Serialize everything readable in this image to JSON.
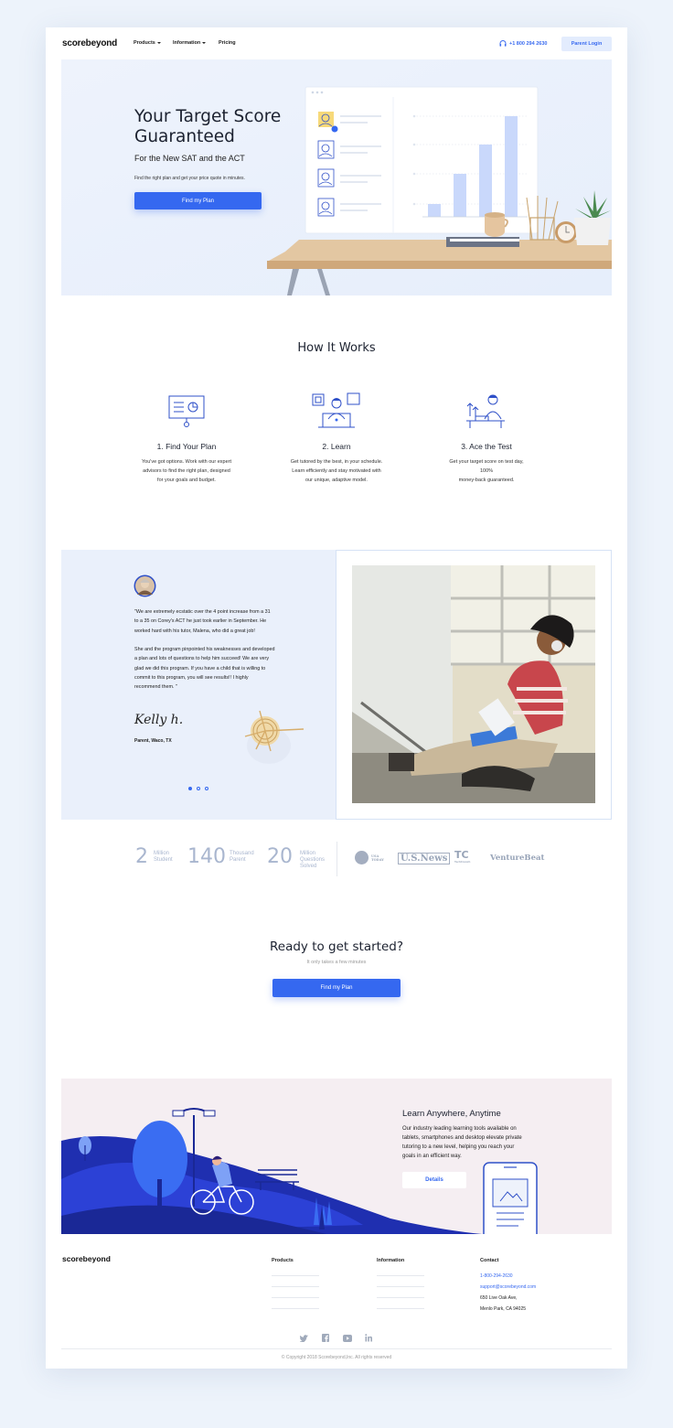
{
  "nav": {
    "logo": "scorebeyond",
    "items": [
      "Products",
      "Information",
      "Pricing"
    ],
    "phone": "+1 800 294 2630",
    "login": "Parent Login"
  },
  "hero": {
    "title_line1": "Your Target Score",
    "title_line2": "Guaranteed",
    "subtitle": "For the New SAT and the ACT",
    "small": "Find the right plan and get your price quote in minutes.",
    "cta": "Find my Plan"
  },
  "how": {
    "title": "How It Works",
    "steps": [
      {
        "title": "1. Find Your Plan",
        "lines": [
          "You've got options. Work with our expert",
          "advisors to find the right plan, designed",
          "for your goals and budget."
        ]
      },
      {
        "title": "2. Learn",
        "lines": [
          "Get tutored by the best, in your schedule.",
          "Learn efficiently and stay motivated with",
          "our unique, adaptive model."
        ]
      },
      {
        "title": "3. Ace the Test",
        "lines": [
          "Get your target score on test day,",
          "100%",
          "money-back guaranteed."
        ]
      }
    ]
  },
  "testimonial": {
    "p1": [
      "\"We are extremely ecstatic over the 4 point increase from a 31",
      "to a 35 on Corey's ACT he just took earlier in September. He",
      "worked hard with his tutor, Malena, who did a great job!"
    ],
    "p2": [
      "She and the program pinpointed his weaknesses and developed",
      "a plan and lots of questions to help him succeed! We are very",
      "glad we did this program. If you have a child that is willing to",
      "commit to this program, you will see results!! I highly",
      "recommend them. \""
    ],
    "signature": "Kelly h.",
    "role": "Parent, Waco, TX"
  },
  "stats": [
    {
      "num": "2",
      "label1": "Million",
      "label2": "Student"
    },
    {
      "num": "140",
      "label1": "Thousand",
      "label2": "Parent"
    },
    {
      "num": "20",
      "label1": "Million",
      "label2": "Questions",
      "label3": "Solved"
    }
  ],
  "press": {
    "usa": "USA TODAY",
    "usnews": "U.S.News",
    "tc": "TechCrunch",
    "vb": "VentureBeat"
  },
  "cta": {
    "title": "Ready to get started?",
    "sub": "It only takes a few minutes",
    "button": "Find my Plan"
  },
  "learn": {
    "title": "Learn Anywhere, Anytime",
    "desc": [
      "Our industry leading learning tools available on",
      "tablets, smartphones and desktop elevate private",
      "tutoring to a new level, helping you reach your",
      "goals in an efficient way."
    ],
    "button": "Details"
  },
  "footer": {
    "logo": "scorebeyond",
    "products": "Products",
    "information": "Information",
    "contact": "Contact",
    "phone": "1-800-294-2630",
    "email": "support@scorebeyond.com",
    "address1": "650 Live Oak Ave,",
    "address2": "Menlo Park, CA 94025",
    "copyright": "© Copyright 2018 Scorebeyond,Inc. All rights reserved"
  },
  "colors": {
    "accent": "#3568f0",
    "hero_bg": "#e8effb",
    "learn_bg": "#f5eef2",
    "illustration_blue": "#1f2fb0"
  }
}
